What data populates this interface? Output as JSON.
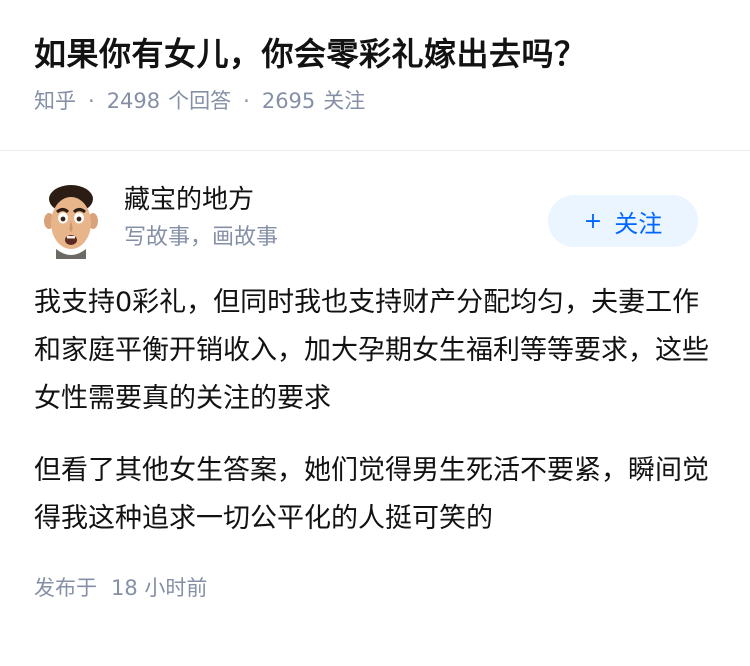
{
  "question": {
    "title": "如果你有女儿，你会零彩礼嫁出去吗？",
    "source": "知乎",
    "answer_count": "2498",
    "answer_label": "个回答",
    "follower_count": "2695",
    "follower_label": "关注"
  },
  "answer": {
    "author_name": "藏宝的地方",
    "author_bio": "写故事，画故事",
    "follow_label": "关注",
    "follow_icon": "plus-icon",
    "paragraphs": [
      "我支持0彩礼，但同时我也支持财产分配均匀，夫妻工作和家庭平衡开销收入，加大孕期女生福利等等要求，这些女性需要真的关注的要求",
      "但看了其他女生答案，她们觉得男生死活不要紧，瞬间觉得我这种追求一切公平化的人挺可笑的"
    ],
    "published_label": "发布于",
    "published_time": "18 小时前"
  },
  "colors": {
    "meta_gray": "#8590a6",
    "accent_blue": "#0066ff",
    "button_bg": "#ebf5ff"
  }
}
